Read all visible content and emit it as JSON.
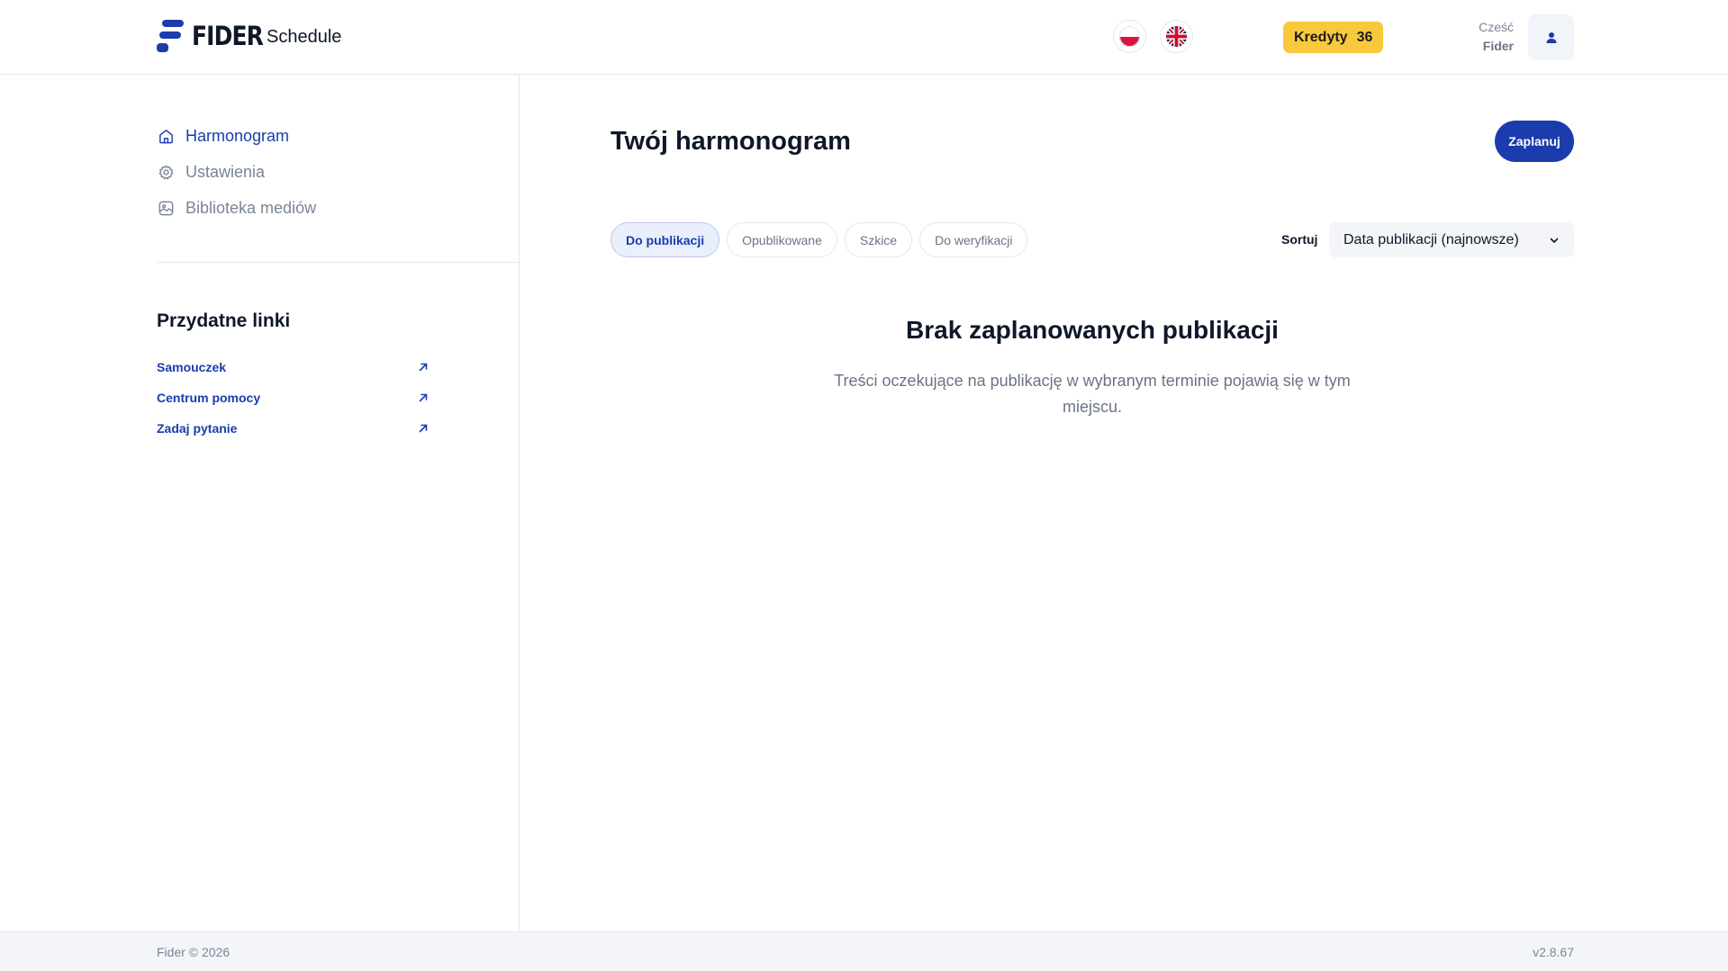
{
  "header": {
    "logo_text": "FIDER",
    "app_name": "Schedule",
    "lang_pl_icon": "flag-pl-icon",
    "lang_en_icon": "flag-gb-icon",
    "credits_label": "Kredyty",
    "credits_value": "36",
    "greeting": "Cześć",
    "user_name": "Fider",
    "user_icon": "user-icon"
  },
  "sidebar": {
    "nav": [
      {
        "label": "Harmonogram",
        "icon": "home-icon",
        "active": true
      },
      {
        "label": "Ustawienia",
        "icon": "gear-icon",
        "active": false
      },
      {
        "label": "Biblioteka mediów",
        "icon": "image-icon",
        "active": false
      }
    ],
    "links_title": "Przydatne linki",
    "links": [
      {
        "label": "Samouczek",
        "icon": "external-arrow-icon"
      },
      {
        "label": "Centrum pomocy",
        "icon": "external-arrow-icon"
      },
      {
        "label": "Zadaj pytanie",
        "icon": "external-arrow-icon"
      }
    ]
  },
  "main": {
    "title": "Twój harmonogram",
    "primary_button": "Zaplanuj",
    "tabs": [
      {
        "label": "Do publikacji",
        "active": true
      },
      {
        "label": "Opublikowane",
        "active": false
      },
      {
        "label": "Szkice",
        "active": false
      },
      {
        "label": "Do weryfikacji",
        "active": false
      }
    ],
    "sort_label": "Sortuj",
    "sort_value": "Data publikacji (najnowsze)",
    "empty_title": "Brak zaplanowanych publikacji",
    "empty_text": "Treści oczekujące na publikację w wybranym terminie pojawią się w tym miejscu."
  },
  "footer": {
    "copyright": "Fider © 2026",
    "version": "v2.8.67"
  },
  "colors": {
    "brand": "#1a3cad",
    "credits_bg": "#f9c93d",
    "muted": "#7a8597"
  }
}
